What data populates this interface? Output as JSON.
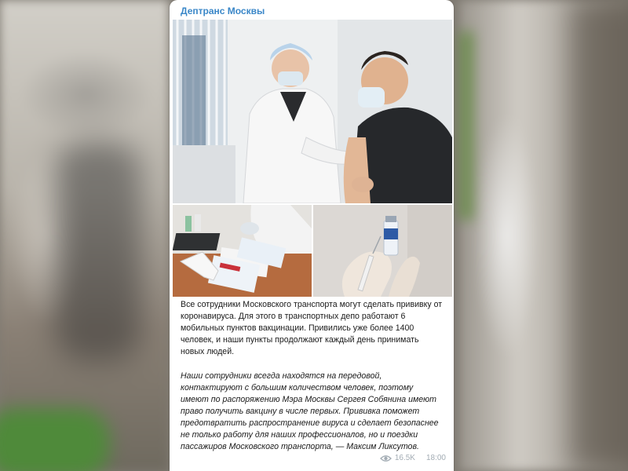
{
  "channel": {
    "name": "Дептранс Москвы"
  },
  "post": {
    "paragraph1": "Все сотрудники Московского транспорта могут сделать прививку от коронавируса. Для этого в транспортных депо работают 6 мобильных пунктов вакцинации. Привились уже более 1400 человек, и наши пункты продолжают каждый день принимать новых людей.",
    "paragraph2": "Наши сотрудники всегда находятся на передовой, контактируют с большим количеством человек, поэтому имеют по распоряжению Мэра Москвы Сергея Собянина имеют право получить вакцину в числе первых. Прививка поможет предотвратить распространение вируса и сделает безопаснее не только работу для наших профессионалов, но и поездки пассажиров Московского транспорта, — Максим Ликсутов.",
    "views": "16.5K",
    "time": "18:00"
  },
  "icons": {
    "views": "eye-icon"
  },
  "colors": {
    "channel_name": "#3a87c8",
    "meta": "#a3acb4"
  }
}
